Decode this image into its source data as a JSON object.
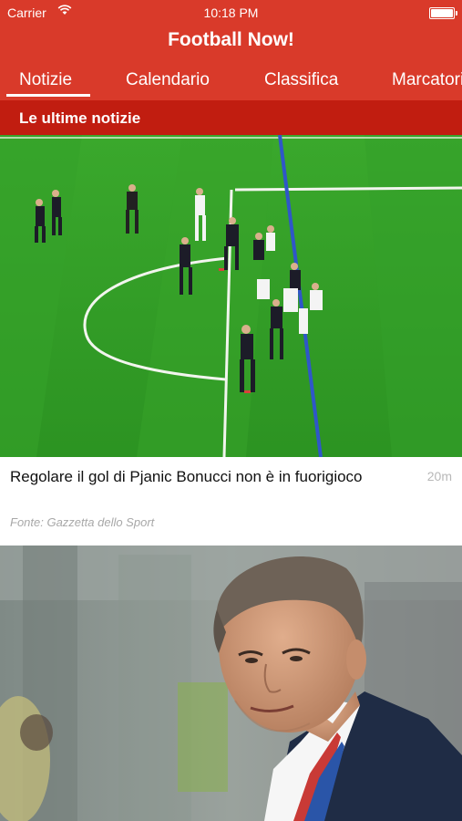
{
  "status_bar": {
    "carrier": "Carrier",
    "time": "10:18 PM"
  },
  "header": {
    "title": "Football Now!"
  },
  "tabs": [
    {
      "label": "Notizie",
      "selected": true
    },
    {
      "label": "Calendario",
      "selected": false
    },
    {
      "label": "Classifica",
      "selected": false
    },
    {
      "label": "Marcatori",
      "selected": false
    }
  ],
  "section": {
    "title": "Le ultime notizie"
  },
  "news": [
    {
      "headline": "Regolare il gol di Pjanic Bonucci non è in fuorigioco",
      "time_ago": "20m",
      "source": "Fonte: Gazzetta dello Sport"
    }
  ],
  "colors": {
    "header": "#d93a2a",
    "section_bar": "#c11d10",
    "pitch": "#2f9e26"
  }
}
